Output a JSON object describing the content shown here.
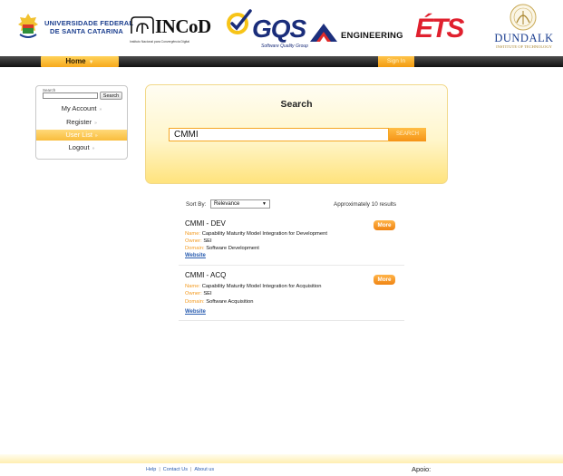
{
  "logos": {
    "ufsc_line1": "UNIVERSIDADE FEDERAL",
    "ufsc_line2": "DE SANTA CATARINA",
    "incod_name": "INCoD",
    "incod_subtitle": "Instituto Nacional para Convergência Digital",
    "gqs_name": "GQS",
    "gqs_subtitle": "Software Quality Group",
    "engineering_name": "ENGINEERING",
    "ets_name": "ÉTS",
    "dundalk_name": "DUNDALK",
    "dundalk_subtitle": "INSTITUTE OF TECHNOLOGY"
  },
  "nav": {
    "home_label": "Home",
    "signin_label": "Sign In"
  },
  "sidebar": {
    "search_label": "Search",
    "search_value": "",
    "search_button": "Search",
    "items": [
      {
        "label": "My Account"
      },
      {
        "label": "Register"
      },
      {
        "label": "User List"
      },
      {
        "label": "Logout"
      }
    ]
  },
  "search": {
    "title": "Search",
    "query": "CMMI",
    "button_label": "SEARCH"
  },
  "results": {
    "sort_label": "Sort By:",
    "sort_value": "Relevance",
    "count_text": "Approximately 10 results",
    "items": [
      {
        "title": "CMMI - DEV",
        "name_key": "Name:",
        "name": "Capability Maturity Model Integration for Development",
        "owner_key": "Owner:",
        "owner": "SEI",
        "domain_key": "Domain:",
        "domain": "Software Development",
        "website": "Website",
        "more": "More"
      },
      {
        "title": "CMMI - ACQ",
        "name_key": "Name:",
        "name": "Capability Maturity Model Integration for Acquisition",
        "owner_key": "Owner:",
        "owner": "SEI",
        "domain_key": "Domain:",
        "domain": "Software Acquisition",
        "website": "Website",
        "more": "More"
      }
    ]
  },
  "footer": {
    "help": "Help",
    "contact": "Contact Us",
    "about": "About us",
    "apoio": "Apoio:"
  },
  "colors": {
    "accent": "#f7a81b",
    "navbar": "#1e1e1e",
    "link": "#2a5db0",
    "field_key": "#f39a1f"
  }
}
